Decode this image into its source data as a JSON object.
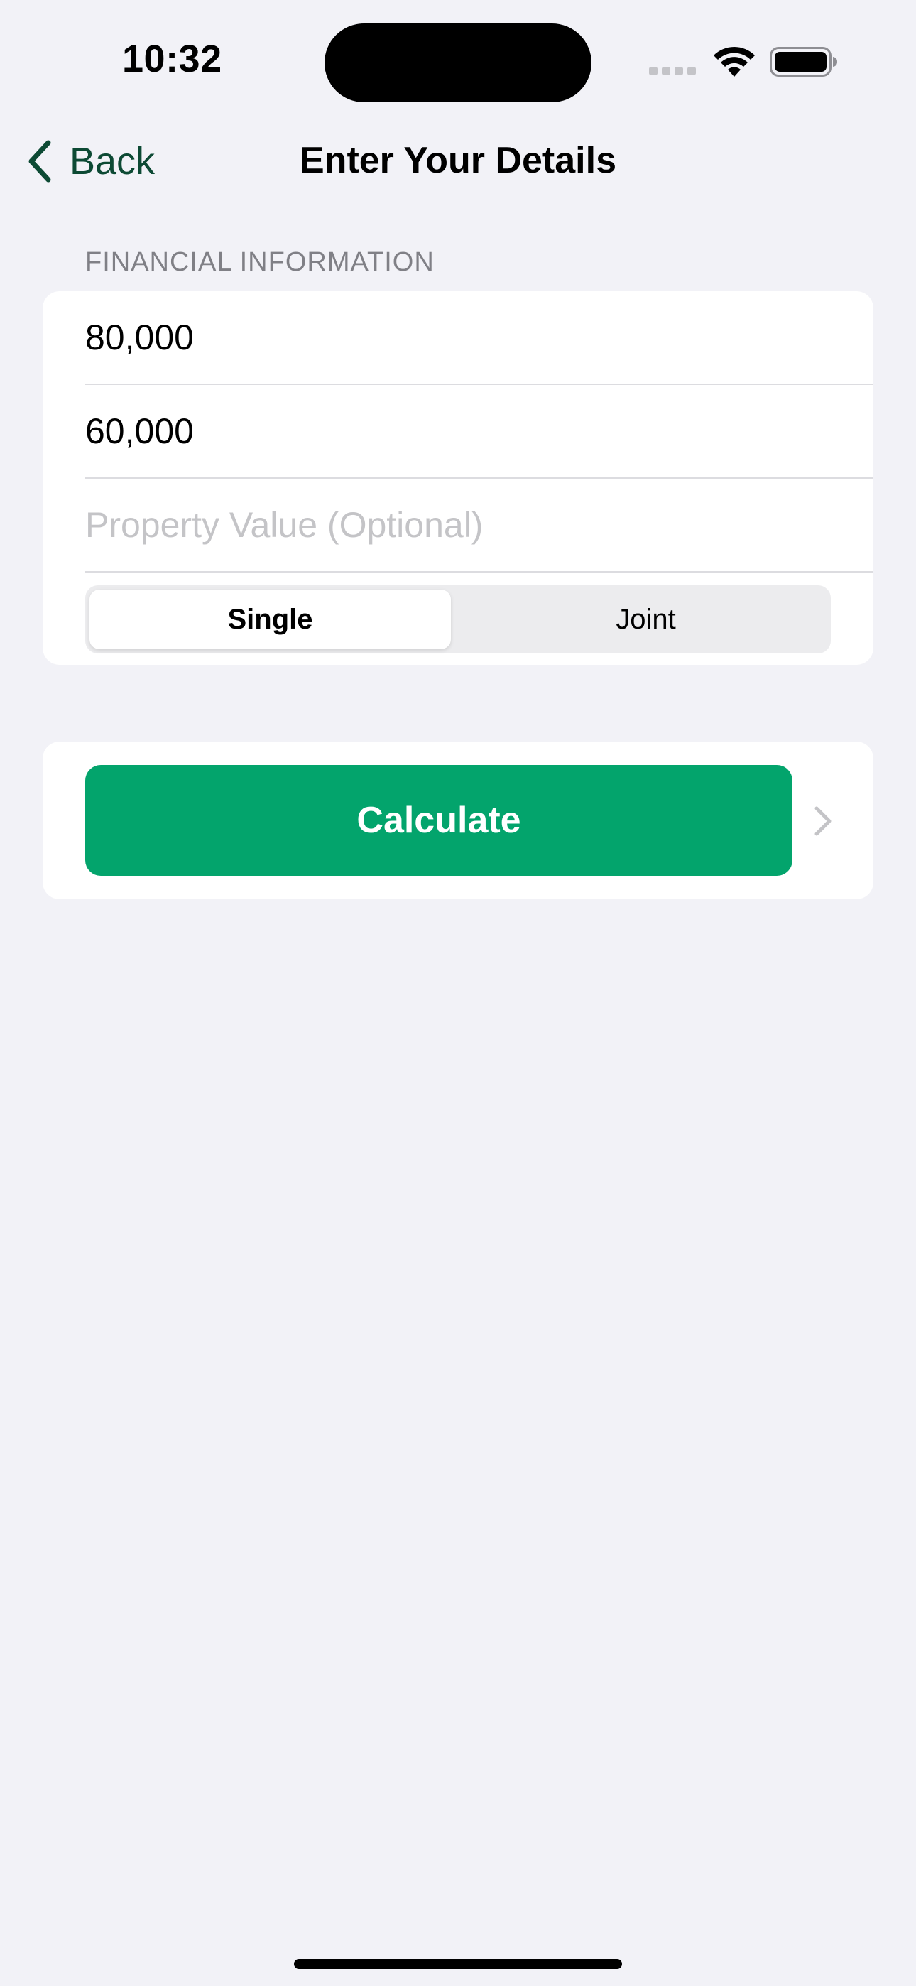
{
  "status_bar": {
    "time": "10:32"
  },
  "nav": {
    "back_label": "Back",
    "title": "Enter Your Details"
  },
  "form": {
    "section_header": "FINANCIAL INFORMATION",
    "field_1_value": "80,000",
    "field_2_value": "60,000",
    "field_3_placeholder": "Property Value (Optional)",
    "segments": [
      {
        "label": "Single",
        "selected": true
      },
      {
        "label": "Joint",
        "selected": false
      }
    ]
  },
  "action": {
    "calculate_label": "Calculate"
  },
  "colors": {
    "accent": "#03a46c",
    "back_tint": "#0d4a34",
    "background": "#f2f2f7"
  }
}
